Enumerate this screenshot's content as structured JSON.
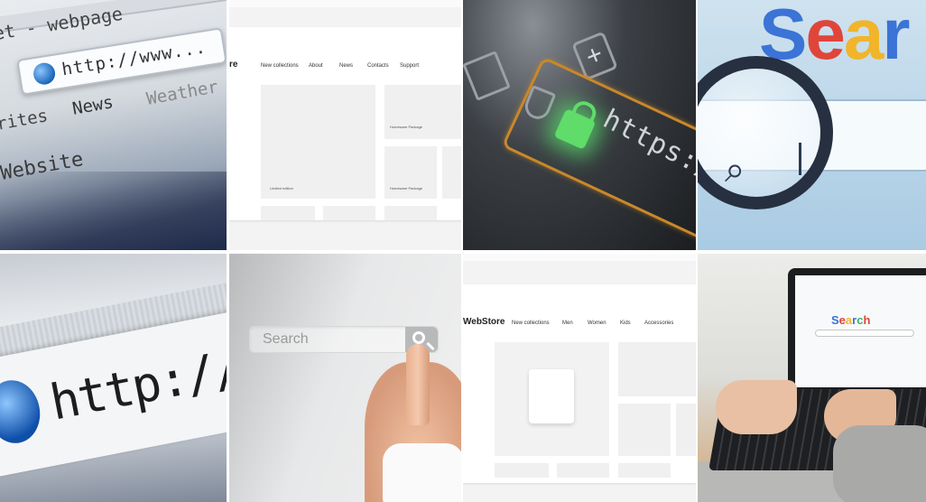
{
  "tiles": {
    "browser_closeup": {
      "title_text": "et - webpage",
      "url_text": "http://www...",
      "tab_news": "News",
      "tab_weather": "Weather",
      "tab_favorites": "rites",
      "website_text": "Website"
    },
    "store_wireframe_1": {
      "nav": [
        "New collections",
        "About",
        "News",
        "Contacts",
        "Support"
      ],
      "logo_fragment": "re",
      "captions": [
        "Limited edition",
        "Homeware Package",
        "Homeware Package"
      ]
    },
    "https_lock": {
      "https_text": "https://www"
    },
    "search_magnifier": {
      "word_parts": [
        "S",
        "e",
        "a",
        "r"
      ]
    },
    "http_zoom": {
      "http_text": "http://ww"
    },
    "search_finger": {
      "search_placeholder": "Search"
    },
    "store_wireframe_2": {
      "logo": "WebStore",
      "nav": [
        "New collections",
        "Men",
        "Women",
        "Kids",
        "Accessories"
      ]
    },
    "laptop": {
      "logo_letters": [
        "S",
        "e",
        "a",
        "r",
        "c",
        "h"
      ]
    }
  }
}
